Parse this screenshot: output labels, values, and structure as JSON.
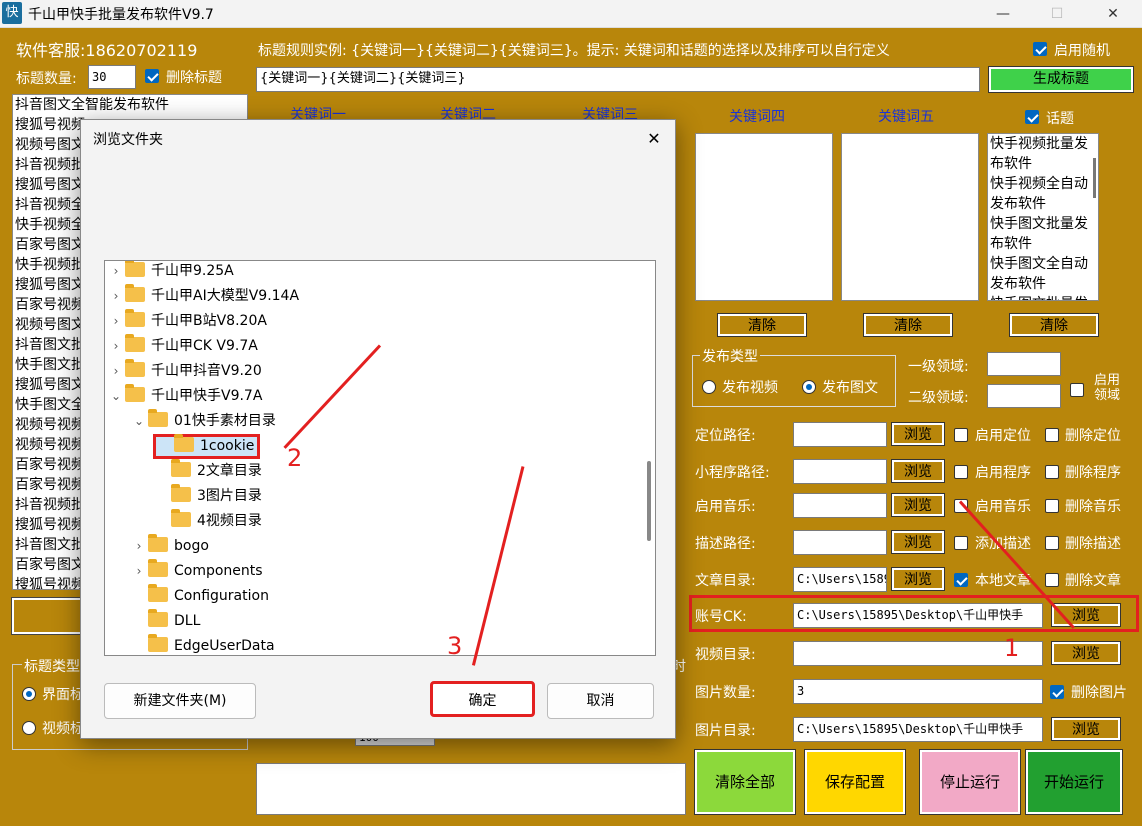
{
  "window": {
    "title": "千山甲快手批量发布软件V9.7",
    "icon": "快",
    "min": "—",
    "max": "☐",
    "close": "✕"
  },
  "left": {
    "service": "软件客服:18620702119",
    "title_count_label": "标题数量:",
    "title_count_value": "30",
    "delete_title_label": "删除标题",
    "titles": [
      "抖音图文全智能发布软件",
      "搜狐号视频",
      "视频号图文",
      "抖音视频批",
      "搜狐号图文",
      "抖音视频全",
      "快手视频全",
      "百家号图文",
      "快手视频批",
      "搜狐号图文",
      "百家号视频",
      "视频号图文",
      "抖音图文批",
      "快手图文批",
      "搜狐号图文",
      "快手图文全",
      "视频号视频",
      "视频号视频",
      "百家号视频",
      "百家号视频",
      "抖音视频批",
      "搜狐号视频",
      "抖音图文批",
      "百家号图文",
      "搜狐号视频"
    ],
    "title_type_label": "标题类型",
    "type_opt1": "界面标",
    "type_opt2": "视频标"
  },
  "rule": {
    "example": "标题规则实例: {关键词一}{关键词二}{关键词三}。提示: 关键词和话题的选择以及排序可以自行定义",
    "enable_random": "启用随机",
    "value": "{关键词一}{关键词二}{关键词三}",
    "generate": "生成标题"
  },
  "keywords": {
    "h1": "关键词一",
    "h2": "关键词二",
    "h3": "关键词三",
    "h4": "关键词四",
    "h5": "关键词五",
    "topic_label": "话题",
    "topics": [
      "快手视频批量发",
      "布软件",
      "快手视频全自动",
      "发布软件",
      "快手图文批量发",
      "布软件",
      "快手图文全自动",
      "发布软件",
      "快手图文批量发"
    ],
    "clear": "清除"
  },
  "publish": {
    "group_label": "发布类型",
    "video": "发布视频",
    "image": "发布图文",
    "level1": "一级领域:",
    "level2": "二级领域:",
    "enable_domain": "启用领域"
  },
  "rows": {
    "location_label": "定位路径:",
    "enable_location": "启用定位",
    "delete_location": "删除定位",
    "program_label": "小程序路径:",
    "enable_program": "启用程序",
    "delete_program": "删除程序",
    "music_label": "启用音乐:",
    "enable_music": "启用音乐",
    "delete_music": "删除音乐",
    "desc_label": "描述路径:",
    "add_desc": "添加描述",
    "delete_desc": "删除描述",
    "article_label": "文章目录:",
    "article_value": "C:\\Users\\15895\\",
    "local_article": "本地文章",
    "delete_article": "删除文章",
    "account_label": "账号CK:",
    "account_value": "C:\\Users\\15895\\Desktop\\千山甲快手",
    "video_label": "视频目录:",
    "image_count_label": "图片数量:",
    "image_count_value": "3",
    "delete_image": "删除图片",
    "image_dir_label": "图片目录:",
    "image_dir_value": "C:\\Users\\15895\\Desktop\\千山甲快手",
    "browse": "浏览"
  },
  "bottom": {
    "clear_all": "清除全部",
    "save": "保存配置",
    "stop": "停止运行",
    "start": "开始运行",
    "partial_char": "时",
    "partial_value": "100"
  },
  "dialog": {
    "title": "浏览文件夹",
    "close": "✕",
    "tree": [
      {
        "label": "千山甲9.25A"
      },
      {
        "label": "千山甲AI大模型V9.14A"
      },
      {
        "label": "千山甲B站V8.20A"
      },
      {
        "label": "千山甲CK V9.7A"
      },
      {
        "label": "千山甲抖音V9.20"
      },
      {
        "label": "千山甲快手V9.7A"
      },
      {
        "label": "01快手素材目录"
      },
      {
        "label": "1cookie"
      },
      {
        "label": "2文章目录"
      },
      {
        "label": "3图片目录"
      },
      {
        "label": "4视频目录"
      },
      {
        "label": "bogo"
      },
      {
        "label": "Components"
      },
      {
        "label": "Configuration"
      },
      {
        "label": "DLL"
      },
      {
        "label": "EdgeUserData"
      }
    ],
    "new_folder": "新建文件夹(M)",
    "ok": "确定",
    "cancel": "取消"
  },
  "annotations": {
    "a1": "1",
    "a2": "2",
    "a3": "3"
  },
  "colors": {
    "background": "#b8860b",
    "accent": "#0067c0",
    "annotation": "#e32020",
    "generate": "#3fd14a",
    "clear_all": "#8cd93b",
    "save": "#ffd700",
    "stop": "#f2a9c6",
    "start": "#22a030"
  }
}
